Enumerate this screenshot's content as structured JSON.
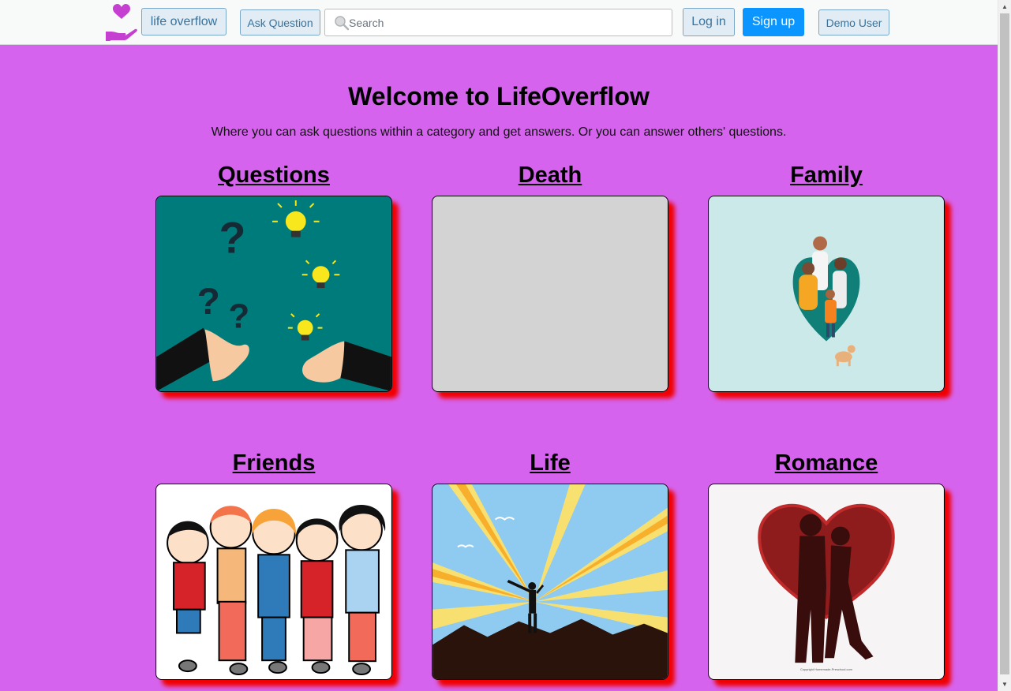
{
  "navbar": {
    "home_label": "life overflow",
    "ask_label": "Ask Question",
    "search_placeholder": "Search",
    "login_label": "Log in",
    "signup_label": "Sign up",
    "demo_label": "Demo User"
  },
  "hero": {
    "title": "Welcome to LifeOverflow",
    "subtitle": "Where you can ask questions within a category and get answers. Or you can answer others' questions."
  },
  "categories": [
    {
      "label": "Questions",
      "image": "questions-illustration"
    },
    {
      "label": "Death",
      "image": "death-placeholder"
    },
    {
      "label": "Family",
      "image": "family-illustration"
    },
    {
      "label": "Friends",
      "image": "friends-illustration"
    },
    {
      "label": "Life",
      "image": "life-illustration"
    },
    {
      "label": "Romance",
      "image": "romance-illustration"
    }
  ],
  "colors": {
    "page_background": "#d663ee",
    "card_shadow": "#f00000",
    "primary_button": "#0a95ff",
    "logo": "#c53fd0"
  }
}
